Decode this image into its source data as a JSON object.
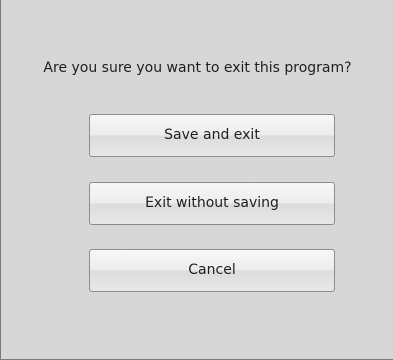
{
  "dialog": {
    "question": "Are you sure you want to exit this program?",
    "buttons": {
      "save_and_exit": "Save and exit",
      "exit_without_saving": "Exit without saving",
      "cancel": "Cancel"
    }
  },
  "colors": {
    "background": "#d7d7d7",
    "button_border": "#8c8c8c",
    "text": "#1e1e1e"
  }
}
